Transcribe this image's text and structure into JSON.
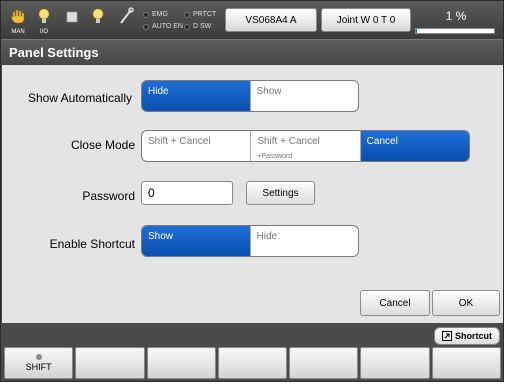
{
  "topbar": {
    "icons": [
      {
        "name": "hand-icon",
        "caption": "MAN"
      },
      {
        "name": "io-bulb-icon",
        "caption": "I/O"
      },
      {
        "name": "stop-square-icon",
        "caption": ""
      },
      {
        "name": "bulb-icon",
        "caption": ""
      },
      {
        "name": "wrench-icon",
        "caption": ""
      }
    ],
    "indicators": [
      "EMG",
      "AUTO EN",
      "PRTCT",
      "D SW"
    ],
    "robot_label": "VS068A4 A",
    "joint_label": "Joint  W 0 T 0",
    "speed_label": "1 %",
    "speed_fraction": 0.01
  },
  "title": "Panel Settings",
  "show_automatically": {
    "label": "Show Automatically",
    "options": [
      "Hide",
      "Show"
    ],
    "selected": 0
  },
  "close_mode": {
    "label": "Close Mode",
    "options": [
      {
        "text": "Shift + Cancel",
        "sub": ""
      },
      {
        "text": "Shift + Cancel",
        "sub": "+Password"
      },
      {
        "text": "Cancel",
        "sub": ""
      }
    ],
    "selected": 2
  },
  "password": {
    "label": "Password",
    "value": "0",
    "settings_button": "Settings"
  },
  "enable_shortcut": {
    "label": "Enable Shortcut",
    "options": [
      "Show",
      "Hide"
    ],
    "selected": 0
  },
  "dialog": {
    "cancel": "Cancel",
    "ok": "OK"
  },
  "bottom": {
    "shortcut_button": "Shortcut",
    "fkeys": [
      "SHIFT",
      "",
      "",
      "",
      "",
      "",
      ""
    ]
  },
  "colors": {
    "accent": "#0a4eb0",
    "bar_bg": "#4a4a4a",
    "content_bg": "#e4e4e4"
  }
}
